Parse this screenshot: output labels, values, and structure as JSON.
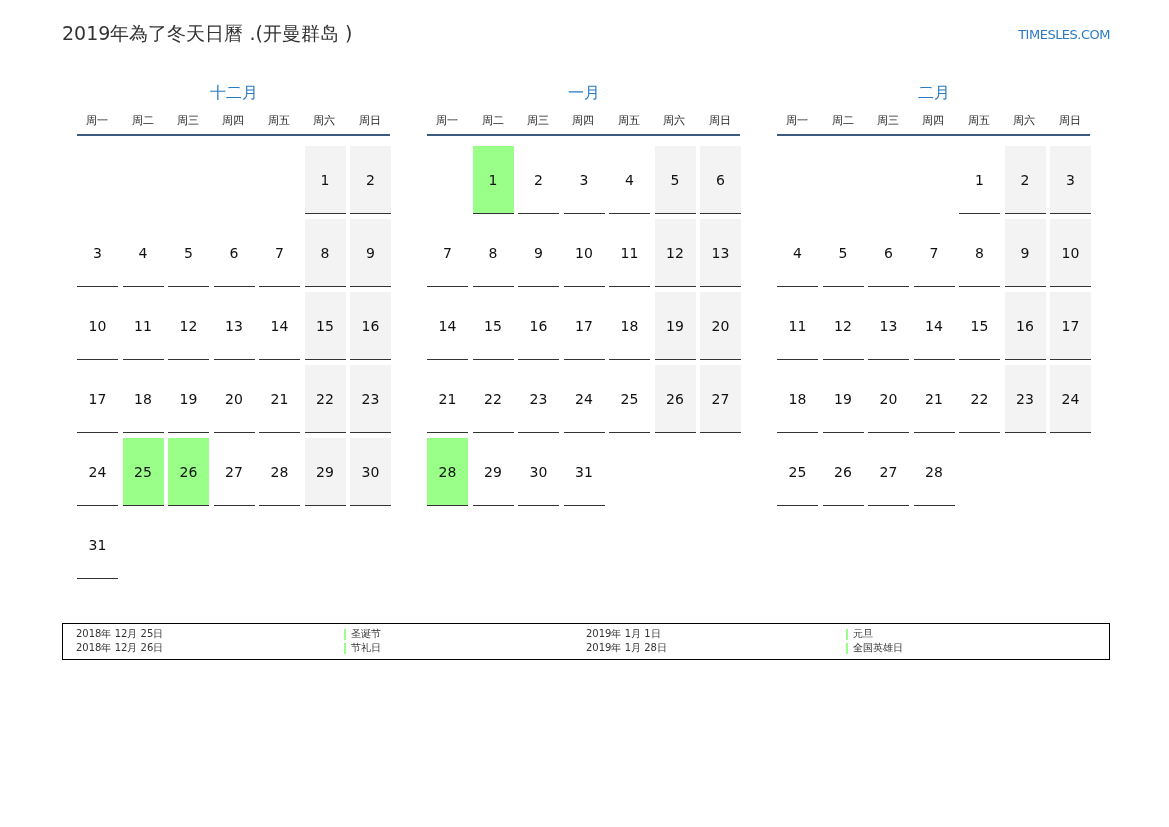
{
  "title": "2019年為了冬天日曆 .(开曼群岛 )",
  "logo": "TIMESLES.COM",
  "months": [
    {
      "name": "十二月",
      "weekdays": [
        "周一",
        "周二",
        "周三",
        "周四",
        "周五",
        "周六",
        "周日"
      ],
      "cells": [
        {
          "kind": "blank"
        },
        {
          "kind": "blank"
        },
        {
          "kind": "blank"
        },
        {
          "kind": "blank"
        },
        {
          "kind": "blank"
        },
        {
          "kind": "day",
          "day": "1",
          "weekend": true,
          "holiday": false
        },
        {
          "kind": "day",
          "day": "2",
          "weekend": true,
          "holiday": false
        },
        {
          "kind": "day",
          "day": "3",
          "weekend": false,
          "holiday": false
        },
        {
          "kind": "day",
          "day": "4",
          "weekend": false,
          "holiday": false
        },
        {
          "kind": "day",
          "day": "5",
          "weekend": false,
          "holiday": false
        },
        {
          "kind": "day",
          "day": "6",
          "weekend": false,
          "holiday": false
        },
        {
          "kind": "day",
          "day": "7",
          "weekend": false,
          "holiday": false
        },
        {
          "kind": "day",
          "day": "8",
          "weekend": true,
          "holiday": false
        },
        {
          "kind": "day",
          "day": "9",
          "weekend": true,
          "holiday": false
        },
        {
          "kind": "day",
          "day": "10",
          "weekend": false,
          "holiday": false
        },
        {
          "kind": "day",
          "day": "11",
          "weekend": false,
          "holiday": false
        },
        {
          "kind": "day",
          "day": "12",
          "weekend": false,
          "holiday": false
        },
        {
          "kind": "day",
          "day": "13",
          "weekend": false,
          "holiday": false
        },
        {
          "kind": "day",
          "day": "14",
          "weekend": false,
          "holiday": false
        },
        {
          "kind": "day",
          "day": "15",
          "weekend": true,
          "holiday": false
        },
        {
          "kind": "day",
          "day": "16",
          "weekend": true,
          "holiday": false
        },
        {
          "kind": "day",
          "day": "17",
          "weekend": false,
          "holiday": false
        },
        {
          "kind": "day",
          "day": "18",
          "weekend": false,
          "holiday": false
        },
        {
          "kind": "day",
          "day": "19",
          "weekend": false,
          "holiday": false
        },
        {
          "kind": "day",
          "day": "20",
          "weekend": false,
          "holiday": false
        },
        {
          "kind": "day",
          "day": "21",
          "weekend": false,
          "holiday": false
        },
        {
          "kind": "day",
          "day": "22",
          "weekend": true,
          "holiday": false
        },
        {
          "kind": "day",
          "day": "23",
          "weekend": true,
          "holiday": false
        },
        {
          "kind": "day",
          "day": "24",
          "weekend": false,
          "holiday": false
        },
        {
          "kind": "day",
          "day": "25",
          "holiday": true
        },
        {
          "kind": "day",
          "day": "26",
          "holiday": true
        },
        {
          "kind": "day",
          "day": "27",
          "weekend": false,
          "holiday": false
        },
        {
          "kind": "day",
          "day": "28",
          "weekend": false,
          "holiday": false
        },
        {
          "kind": "day",
          "day": "29",
          "weekend": true,
          "holiday": false
        },
        {
          "kind": "day",
          "day": "30",
          "weekend": true,
          "holiday": false
        },
        {
          "kind": "day",
          "day": "31",
          "weekend": false,
          "holiday": false
        }
      ]
    },
    {
      "name": "一月",
      "weekdays": [
        "周一",
        "周二",
        "周三",
        "周四",
        "周五",
        "周六",
        "周日"
      ],
      "cells": [
        {
          "kind": "blank"
        },
        {
          "kind": "day",
          "day": "1",
          "holiday": true
        },
        {
          "kind": "day",
          "day": "2",
          "weekend": false,
          "holiday": false
        },
        {
          "kind": "day",
          "day": "3",
          "weekend": false,
          "holiday": false
        },
        {
          "kind": "day",
          "day": "4",
          "weekend": false,
          "holiday": false
        },
        {
          "kind": "day",
          "day": "5",
          "weekend": true,
          "holiday": false
        },
        {
          "kind": "day",
          "day": "6",
          "weekend": true,
          "holiday": false
        },
        {
          "kind": "day",
          "day": "7",
          "weekend": false,
          "holiday": false
        },
        {
          "kind": "day",
          "day": "8",
          "weekend": false,
          "holiday": false
        },
        {
          "kind": "day",
          "day": "9",
          "weekend": false,
          "holiday": false
        },
        {
          "kind": "day",
          "day": "10",
          "weekend": false,
          "holiday": false
        },
        {
          "kind": "day",
          "day": "11",
          "weekend": false,
          "holiday": false
        },
        {
          "kind": "day",
          "day": "12",
          "weekend": true,
          "holiday": false
        },
        {
          "kind": "day",
          "day": "13",
          "weekend": true,
          "holiday": false
        },
        {
          "kind": "day",
          "day": "14",
          "weekend": false,
          "holiday": false
        },
        {
          "kind": "day",
          "day": "15",
          "weekend": false,
          "holiday": false
        },
        {
          "kind": "day",
          "day": "16",
          "weekend": false,
          "holiday": false
        },
        {
          "kind": "day",
          "day": "17",
          "weekend": false,
          "holiday": false
        },
        {
          "kind": "day",
          "day": "18",
          "weekend": false,
          "holiday": false
        },
        {
          "kind": "day",
          "day": "19",
          "weekend": true,
          "holiday": false
        },
        {
          "kind": "day",
          "day": "20",
          "weekend": true,
          "holiday": false
        },
        {
          "kind": "day",
          "day": "21",
          "weekend": false,
          "holiday": false
        },
        {
          "kind": "day",
          "day": "22",
          "weekend": false,
          "holiday": false
        },
        {
          "kind": "day",
          "day": "23",
          "weekend": false,
          "holiday": false
        },
        {
          "kind": "day",
          "day": "24",
          "weekend": false,
          "holiday": false
        },
        {
          "kind": "day",
          "day": "25",
          "weekend": false,
          "holiday": false
        },
        {
          "kind": "day",
          "day": "26",
          "weekend": true,
          "holiday": false
        },
        {
          "kind": "day",
          "day": "27",
          "weekend": true,
          "holiday": false
        },
        {
          "kind": "day",
          "day": "28",
          "holiday": true
        },
        {
          "kind": "day",
          "day": "29",
          "weekend": false,
          "holiday": false
        },
        {
          "kind": "day",
          "day": "30",
          "weekend": false,
          "holiday": false
        },
        {
          "kind": "day",
          "day": "31",
          "weekend": false,
          "holiday": false
        }
      ]
    },
    {
      "name": "二月",
      "weekdays": [
        "周一",
        "周二",
        "周三",
        "周四",
        "周五",
        "周六",
        "周日"
      ],
      "cells": [
        {
          "kind": "blank"
        },
        {
          "kind": "blank"
        },
        {
          "kind": "blank"
        },
        {
          "kind": "blank"
        },
        {
          "kind": "day",
          "day": "1",
          "weekend": false,
          "holiday": false
        },
        {
          "kind": "day",
          "day": "2",
          "weekend": true,
          "holiday": false
        },
        {
          "kind": "day",
          "day": "3",
          "weekend": true,
          "holiday": false
        },
        {
          "kind": "day",
          "day": "4",
          "weekend": false,
          "holiday": false
        },
        {
          "kind": "day",
          "day": "5",
          "weekend": false,
          "holiday": false
        },
        {
          "kind": "day",
          "day": "6",
          "weekend": false,
          "holiday": false
        },
        {
          "kind": "day",
          "day": "7",
          "weekend": false,
          "holiday": false
        },
        {
          "kind": "day",
          "day": "8",
          "weekend": false,
          "holiday": false
        },
        {
          "kind": "day",
          "day": "9",
          "weekend": true,
          "holiday": false
        },
        {
          "kind": "day",
          "day": "10",
          "weekend": true,
          "holiday": false
        },
        {
          "kind": "day",
          "day": "11",
          "weekend": false,
          "holiday": false
        },
        {
          "kind": "day",
          "day": "12",
          "weekend": false,
          "holiday": false
        },
        {
          "kind": "day",
          "day": "13",
          "weekend": false,
          "holiday": false
        },
        {
          "kind": "day",
          "day": "14",
          "weekend": false,
          "holiday": false
        },
        {
          "kind": "day",
          "day": "15",
          "weekend": false,
          "holiday": false
        },
        {
          "kind": "day",
          "day": "16",
          "weekend": true,
          "holiday": false
        },
        {
          "kind": "day",
          "day": "17",
          "weekend": true,
          "holiday": false
        },
        {
          "kind": "day",
          "day": "18",
          "weekend": false,
          "holiday": false
        },
        {
          "kind": "day",
          "day": "19",
          "weekend": false,
          "holiday": false
        },
        {
          "kind": "day",
          "day": "20",
          "weekend": false,
          "holiday": false
        },
        {
          "kind": "day",
          "day": "21",
          "weekend": false,
          "holiday": false
        },
        {
          "kind": "day",
          "day": "22",
          "weekend": false,
          "holiday": false
        },
        {
          "kind": "day",
          "day": "23",
          "weekend": true,
          "holiday": false
        },
        {
          "kind": "day",
          "day": "24",
          "weekend": true,
          "holiday": false
        },
        {
          "kind": "day",
          "day": "25",
          "weekend": false,
          "holiday": false
        },
        {
          "kind": "day",
          "day": "26",
          "weekend": false,
          "holiday": false
        },
        {
          "kind": "day",
          "day": "27",
          "weekend": false,
          "holiday": false
        },
        {
          "kind": "day",
          "day": "28",
          "weekend": false,
          "holiday": false
        }
      ]
    }
  ],
  "holidays": [
    {
      "date": "2018年 12月 25日",
      "name": "圣诞节",
      "color": "#99ff88"
    },
    {
      "date": "2018年 12月 26日",
      "name": "节礼日",
      "color": "#99ff88"
    },
    {
      "date": "2019年 1月 1日",
      "name": "元旦",
      "color": "#99ff88"
    },
    {
      "date": "2019年 1月 28日",
      "name": "全国英雄日",
      "color": "#99ff88"
    }
  ]
}
